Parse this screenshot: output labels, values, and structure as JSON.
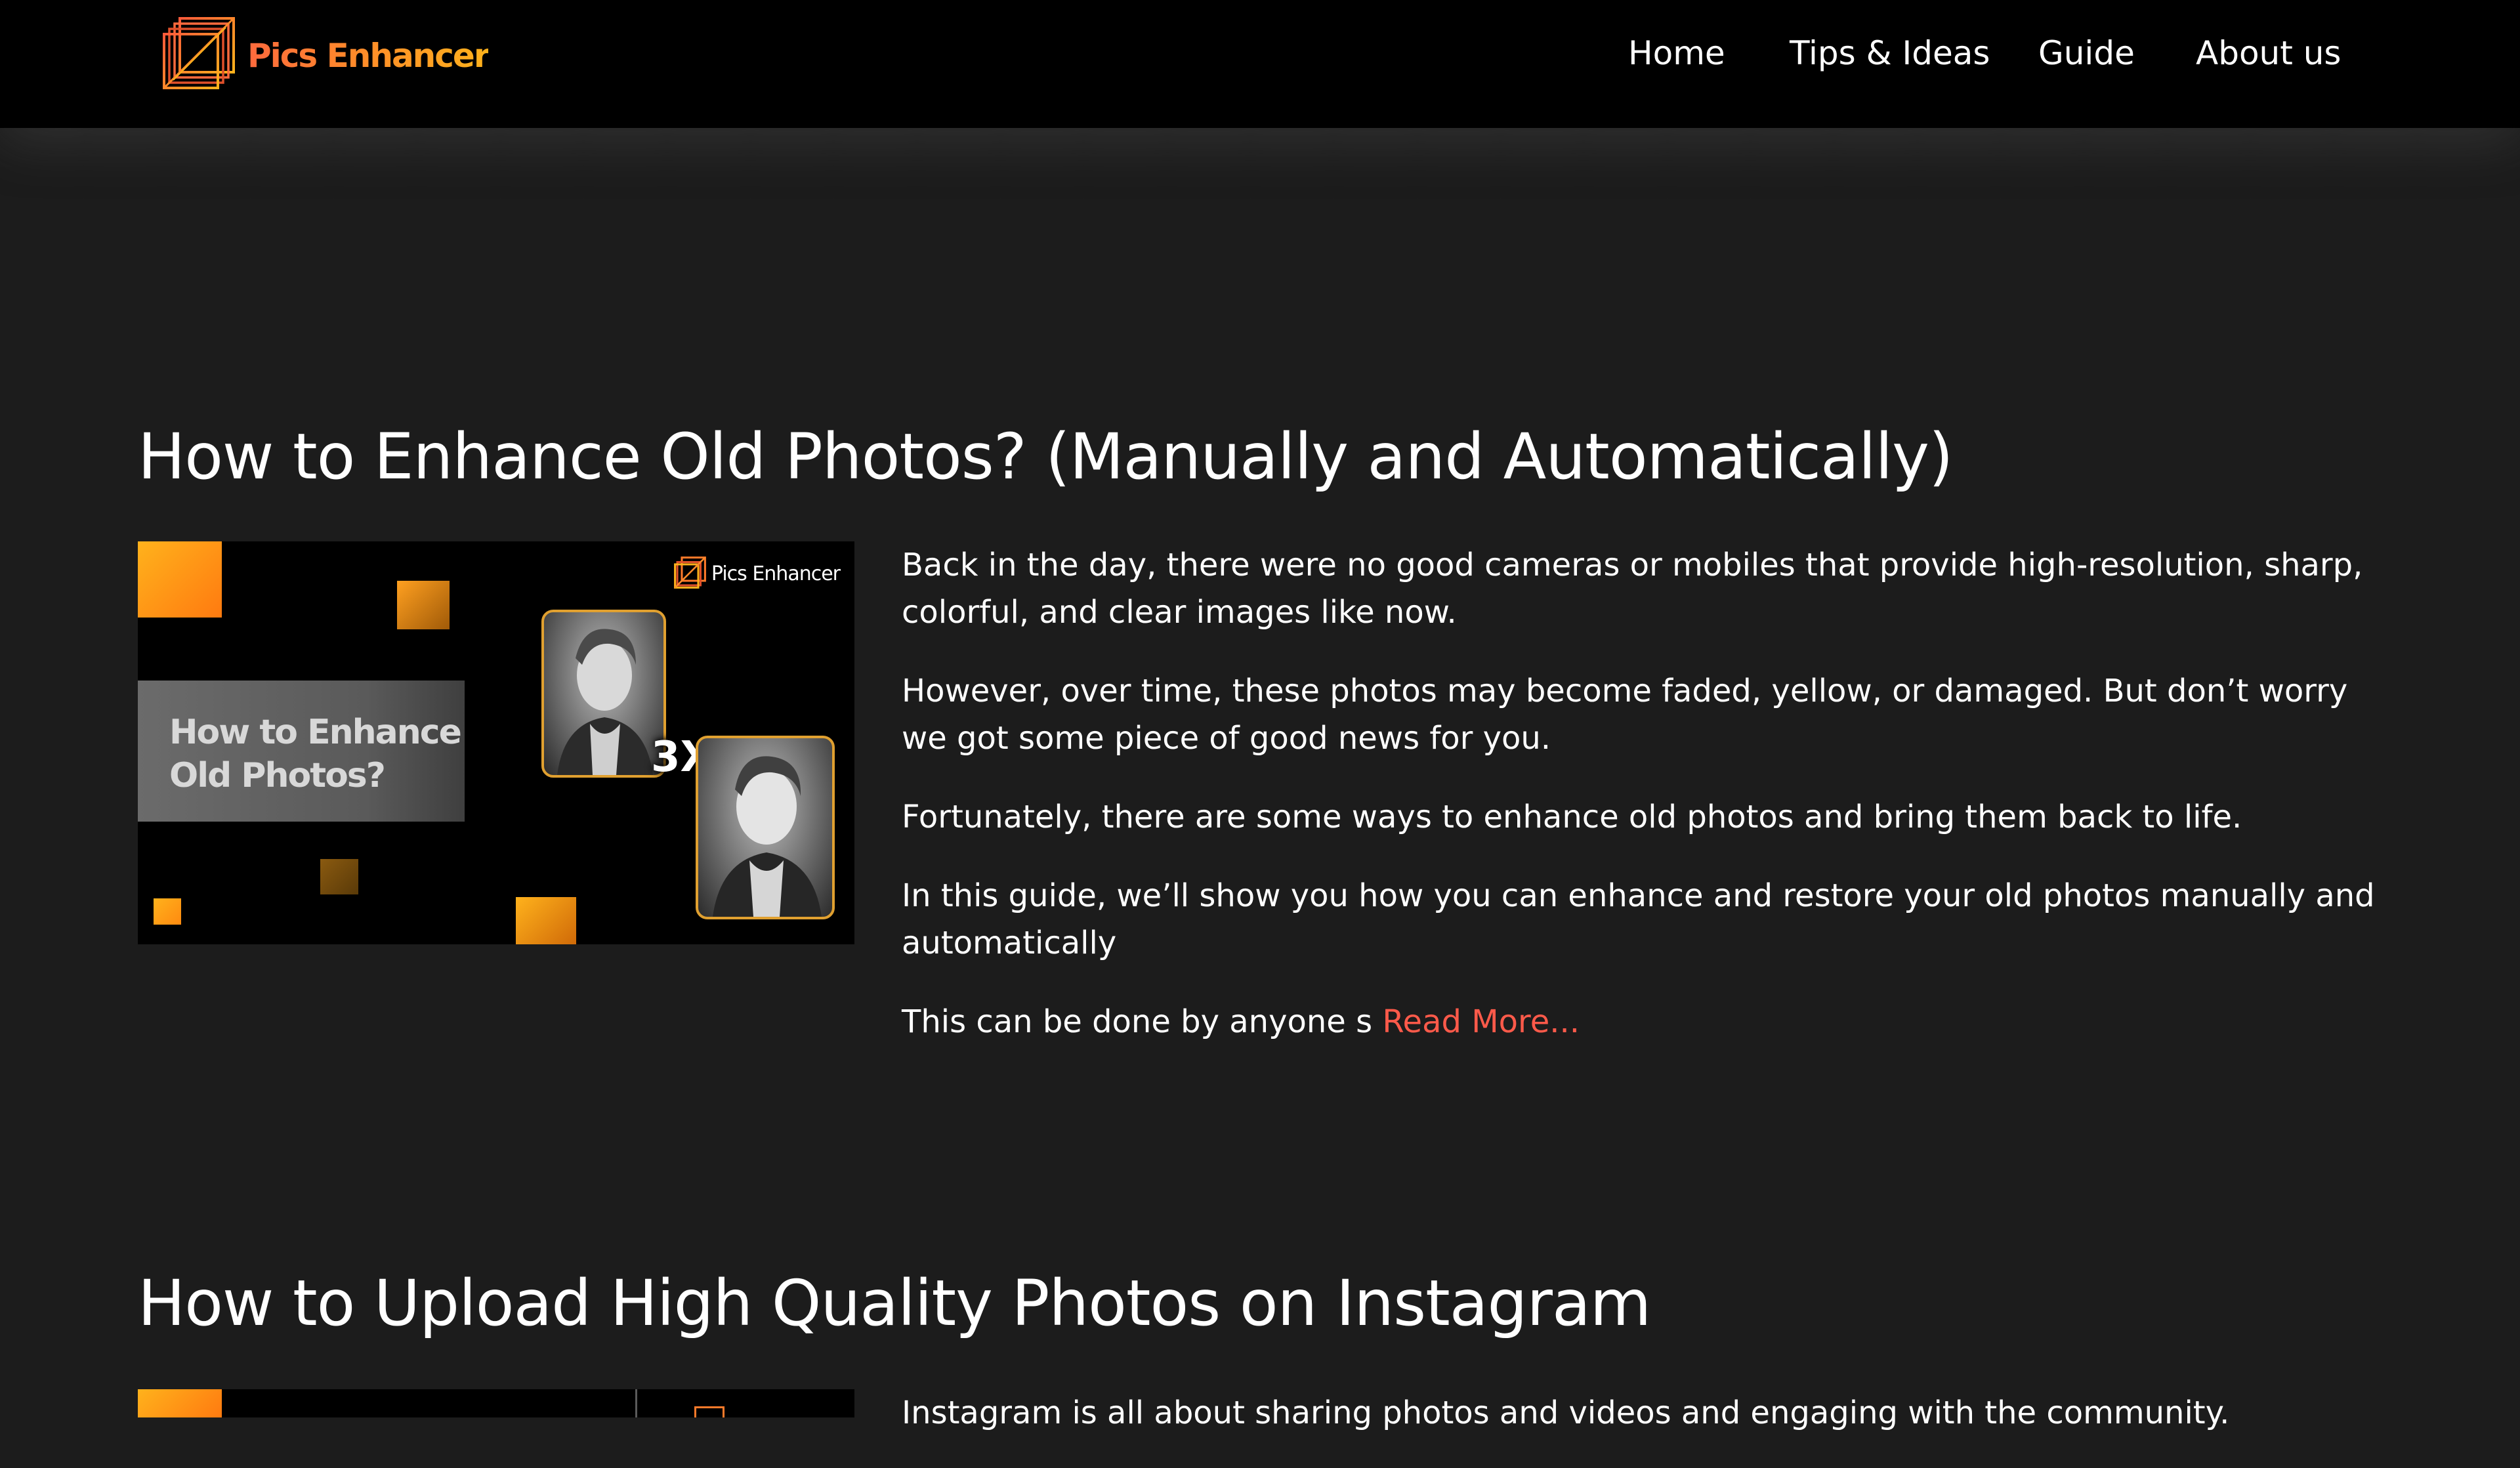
{
  "brand": {
    "name": "Pics Enhancer"
  },
  "nav": {
    "items": [
      {
        "label": "Home"
      },
      {
        "label": "Tips & Ideas"
      },
      {
        "label": "Guide"
      },
      {
        "label": "About us"
      }
    ]
  },
  "posts": [
    {
      "title": "How to Enhance Old Photos? (Manually and Automatically)",
      "thumbnail": {
        "banner_text": "How to Enhance\nOld Photos?",
        "brand": "Pics Enhancer",
        "scale_label": "3X"
      },
      "paragraphs": [
        "Back in the day, there were no good cameras or mobiles that provide high-resolution, sharp, colorful, and clear images like now.",
        "However, over time, these photos may become faded, yellow, or damaged. But don’t worry we got some piece of good news for you.",
        "Fortunately, there are some ways to enhance old photos and bring them back to life.",
        "In this guide, we’ll show you how you can enhance and restore your old photos manually and automatically"
      ],
      "teaser": "This can be done by anyone s ",
      "read_more": "Read More..."
    },
    {
      "title": "How to Upload High Quality Photos on Instagram",
      "paragraphs": [
        "Instagram is all about sharing photos and videos and engaging with the community."
      ]
    }
  ],
  "colors": {
    "background": "#1c1c1c",
    "header": "#000000",
    "accent_link": "#ff5a4a",
    "brand_gradient_start": "#ff6a3d",
    "brand_gradient_end": "#ffb21c",
    "photo_frame": "#e0a030"
  }
}
